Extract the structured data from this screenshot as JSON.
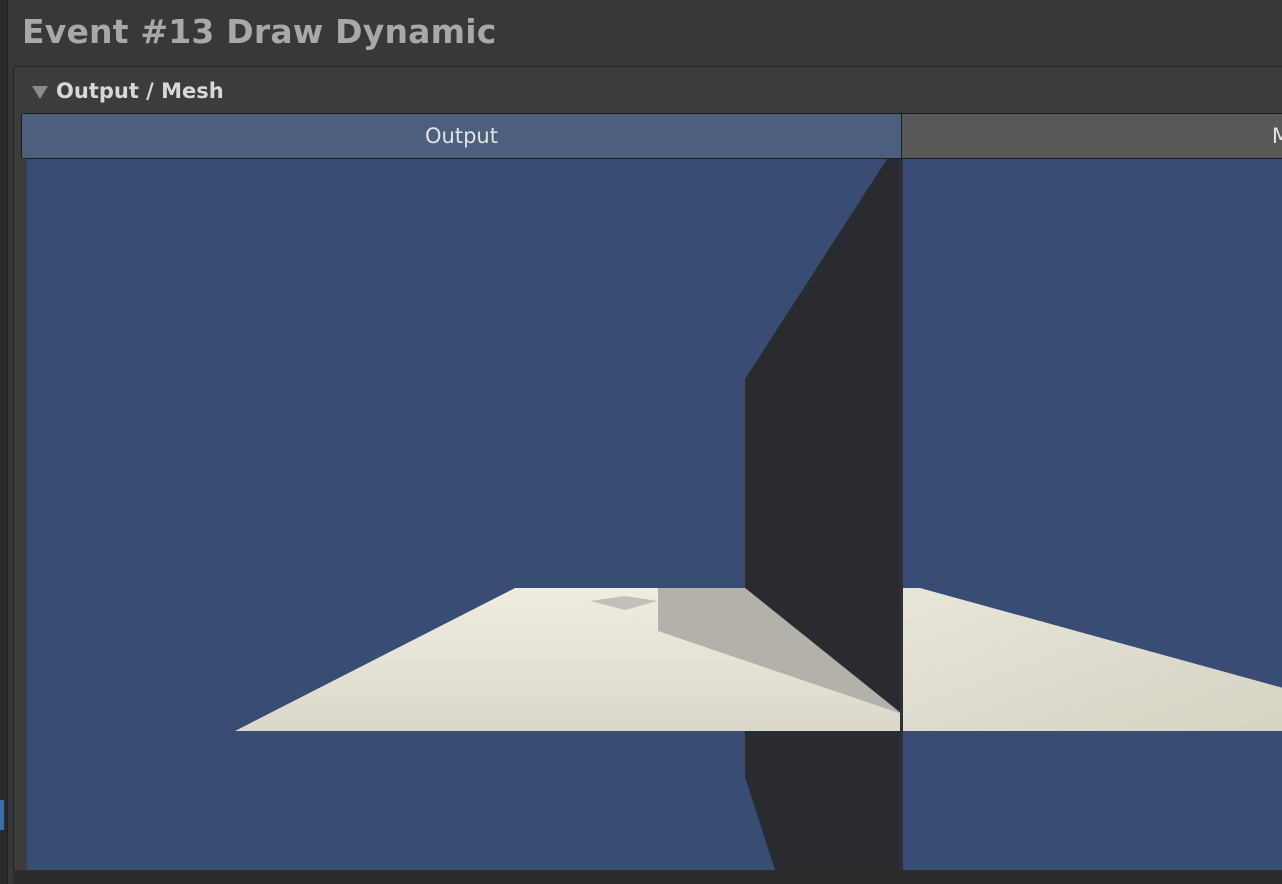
{
  "event": {
    "title": "Event #13 Draw Dynamic"
  },
  "foldout": {
    "label": "Output / Mesh",
    "expanded": true,
    "icon": "triangle-down-icon"
  },
  "tabs": [
    {
      "label": "Output",
      "active": true
    },
    {
      "label": "M",
      "active": false
    }
  ],
  "viewport": {
    "content": "3d-mesh-preview",
    "colors": {
      "background": "#384c74",
      "floor": "#e4e1d4",
      "floor_shadow": "#b3b1a8",
      "wall": "#2a2b31"
    }
  },
  "colors": {
    "window_bg": "#383838",
    "panel_bg": "#3c3c3c",
    "tab_active": "#4c607e",
    "tab_inactive": "#585858",
    "title_text": "#a8a8a8"
  }
}
